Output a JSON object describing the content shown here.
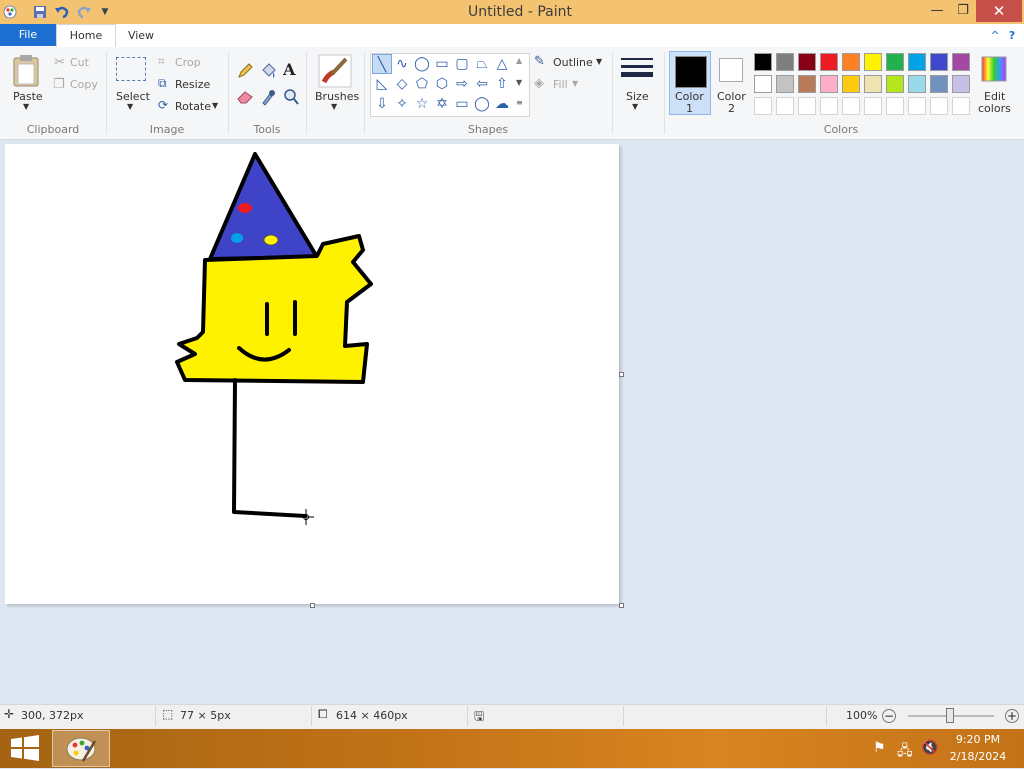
{
  "titlebar": {
    "title": "Untitled - Paint",
    "minimize": "—",
    "maximize": "❐",
    "close": "✕"
  },
  "tabs": {
    "file": "File",
    "home": "Home",
    "view": "View",
    "help": "?",
    "collapse": "^"
  },
  "ribbon": {
    "clipboard": {
      "label": "Clipboard",
      "paste": "Paste",
      "cut": "Cut",
      "copy": "Copy"
    },
    "image": {
      "label": "Image",
      "select": "Select",
      "crop": "Crop",
      "resize": "Resize",
      "rotate": "Rotate"
    },
    "tools": {
      "label": "Tools"
    },
    "brushes": {
      "label": "Brushes"
    },
    "shapes": {
      "label": "Shapes",
      "outline": "Outline",
      "fill": "Fill"
    },
    "size": {
      "label": "Size"
    },
    "color1": {
      "line1": "Color",
      "line2": "1"
    },
    "color2": {
      "line1": "Color",
      "line2": "2"
    },
    "colors": {
      "label": "Colors",
      "edit_line1": "Edit",
      "edit_line2": "colors",
      "row1": [
        "#000000",
        "#7f7f7f",
        "#880015",
        "#ed1c24",
        "#ff7f27",
        "#fff200",
        "#22b14c",
        "#00a2e8",
        "#3f48cc",
        "#a349a4"
      ],
      "row2": [
        "#ffffff",
        "#c3c3c3",
        "#b97a57",
        "#ffaec9",
        "#ffc90e",
        "#efe4b0",
        "#b5e61d",
        "#99d9ea",
        "#7092be",
        "#c8bfe7"
      ]
    }
  },
  "status": {
    "cursor_pos": "300, 372px",
    "selection_size": "77 × 5px",
    "image_size": "614 × 460px",
    "zoom": "100%"
  },
  "taskbar": {
    "time": "9:20 PM",
    "date": "2/18/2024"
  },
  "colors": {
    "title_bar": "#f4c372",
    "file_tab": "#1d6fd1",
    "taskbar": "#c27317",
    "hat": "#3e43c8",
    "face": "#fff200"
  }
}
